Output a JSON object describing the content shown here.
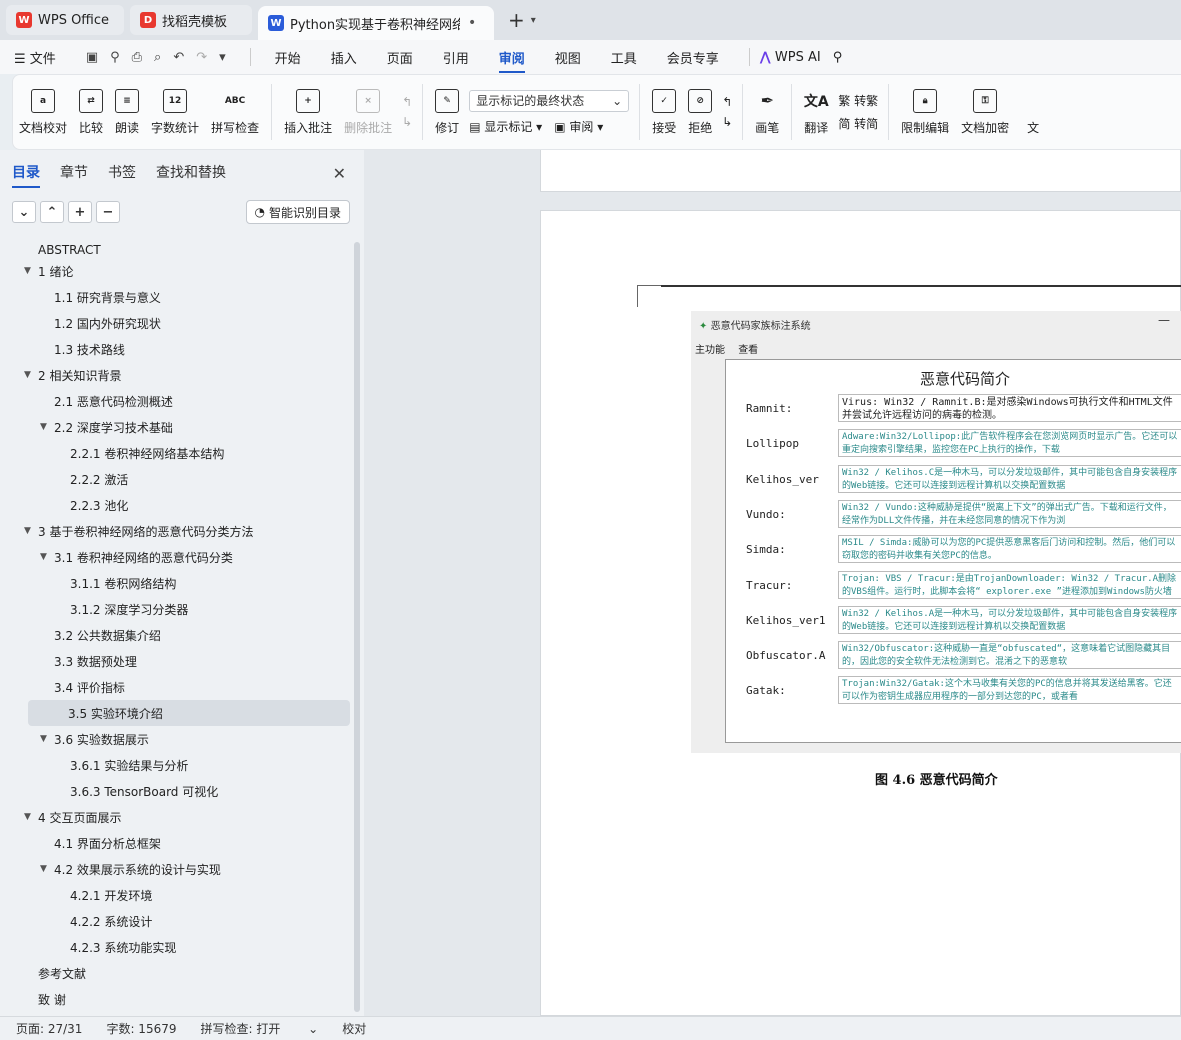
{
  "tabs": [
    {
      "label": "WPS Office",
      "logo": "W",
      "logo_color": "#e8382f"
    },
    {
      "label": "找稻壳模板",
      "logo": "D",
      "logo_color": "#e8382f"
    },
    {
      "label": "Python实现基于卷积神经网络",
      "logo": "W",
      "logo_color": "#2b5cd9",
      "active": true
    }
  ],
  "tab_dot": "•",
  "new_tab": "+",
  "menu": {
    "file": "文件",
    "items": [
      "开始",
      "插入",
      "页面",
      "引用",
      "审阅",
      "视图",
      "工具",
      "会员专享"
    ],
    "active": "审阅",
    "wps_ai": "WPS AI"
  },
  "ribbon": {
    "doc_check": "文档校对",
    "compare": "比较",
    "read": "朗读",
    "word_count": "字数统计",
    "word_count_icon_text": "12",
    "spell_check": "拼写检查",
    "spell_icon_text": "ABC",
    "insert_comment": "插入批注",
    "delete_comment": "删除批注",
    "revise": "修订",
    "markup_state": "显示标记的最终状态",
    "show_markup": "显示标记",
    "review": "审阅",
    "accept": "接受",
    "reject": "拒绝",
    "pen": "画笔",
    "translate": "翻译",
    "to_traditional": "转繁",
    "to_simplified": "转简",
    "restrict_edit": "限制编辑",
    "doc_encrypt": "文档加密",
    "doc_more": "文"
  },
  "nav": {
    "tabs": [
      "目录",
      "章节",
      "书签",
      "查找和替换"
    ],
    "smart_toc": "智能识别目录",
    "toc": [
      {
        "label": "ABSTRACT",
        "level": 0,
        "arrow": false
      },
      {
        "label": "1  绪论",
        "level": 0,
        "arrow": true
      },
      {
        "label": "1.1  研究背景与意义",
        "level": 1,
        "arrow": false
      },
      {
        "label": "1.2  国内外研究现状",
        "level": 1,
        "arrow": false
      },
      {
        "label": "1.3  技术路线",
        "level": 1,
        "arrow": false
      },
      {
        "label": "2  相关知识背景",
        "level": 0,
        "arrow": true
      },
      {
        "label": "2.1  恶意代码检测概述",
        "level": 1,
        "arrow": false
      },
      {
        "label": "2.2  深度学习技术基础",
        "level": 1,
        "arrow": true
      },
      {
        "label": "2.2.1 卷积神经网络基本结构",
        "level": 2,
        "arrow": false
      },
      {
        "label": "2.2.2 激活",
        "level": 2,
        "arrow": false
      },
      {
        "label": "2.2.3 池化",
        "level": 2,
        "arrow": false
      },
      {
        "label": "3  基于卷积神经网络的恶意代码分类方法",
        "level": 0,
        "arrow": true
      },
      {
        "label": "3.1  卷积神经网络的恶意代码分类",
        "level": 1,
        "arrow": true
      },
      {
        "label": "3.1.1 卷积网络结构",
        "level": 2,
        "arrow": false
      },
      {
        "label": "3.1.2  深度学习分类器",
        "level": 2,
        "arrow": false
      },
      {
        "label": "3.2 公共数据集介绍",
        "level": 1,
        "arrow": false
      },
      {
        "label": "3.3 数据预处理",
        "level": 1,
        "arrow": false
      },
      {
        "label": "3.4  评价指标",
        "level": 1,
        "arrow": false
      },
      {
        "label": "3.5  实验环境介绍",
        "level": 1,
        "arrow": false,
        "selected": true
      },
      {
        "label": "3.6  实验数据展示",
        "level": 1,
        "arrow": true
      },
      {
        "label": "3.6.1  实验结果与分析",
        "level": 2,
        "arrow": false
      },
      {
        "label": "3.6.3 TensorBoard 可视化",
        "level": 2,
        "arrow": false
      },
      {
        "label": "4  交互页面展示",
        "level": 0,
        "arrow": true
      },
      {
        "label": "4.1  界面分析总框架",
        "level": 1,
        "arrow": false
      },
      {
        "label": "4.2  效果展示系统的设计与实现",
        "level": 1,
        "arrow": true
      },
      {
        "label": "4.2.1  开发环境",
        "level": 2,
        "arrow": false
      },
      {
        "label": "4.2.2  系统设计",
        "level": 2,
        "arrow": false
      },
      {
        "label": "4.2.3  系统功能实现",
        "level": 2,
        "arrow": false
      },
      {
        "label": "参考文献",
        "level": 0,
        "arrow": false
      },
      {
        "label": "致    谢",
        "level": 0,
        "arrow": false
      }
    ]
  },
  "doc": {
    "window_title": "恶意代码家族标注系统",
    "window_min": "—",
    "window_menu": [
      "主功能",
      "查看"
    ],
    "heading": "恶意代码简介",
    "families": [
      {
        "name": "Ramnit:",
        "desc": "Virus: Win32 / Ramnit.B:是对感染Windows可执行文件和HTML文件并尝试允许远程访问的病毒的检测。",
        "dark": true
      },
      {
        "name": "Lollipop",
        "desc": "Adware:Win32/Lollipop:此广告软件程序会在您浏览网页时显示广告。它还可以重定向搜索引擎结果，监控您在PC上执行的操作，下载"
      },
      {
        "name": "Kelihos_ver",
        "desc": "Win32 / Kelihos.C是一种木马，可以分发垃圾邮件，其中可能包含自身安装程序的Web链接。它还可以连接到远程计算机以交换配置数据"
      },
      {
        "name": "Vundo:",
        "desc": "Win32 / Vundo:这种威胁是提供“脱离上下文”的弹出式广告。下载和运行文件，经常作为DLL文件传播，并在未经您同意的情况下作为浏"
      },
      {
        "name": "Simda:",
        "desc": "MSIL / Simda:威胁可以为您的PC提供恶意黑客后门访问和控制。然后，他们可以窃取您的密码并收集有关您PC的信息。"
      },
      {
        "name": "Tracur:",
        "desc": "Trojan: VBS / Tracur:是由TrojanDownloader: Win32 / Tracur.A删除的VBS组件。运行时，此脚本会将“ explorer.exe ”进程添加到Windows防火墙例外列表中，以故意降低系统安全设"
      },
      {
        "name": "Kelihos_ver1",
        "desc": "Win32 / Kelihos.A是一种木马，可以分发垃圾邮件，其中可能包含自身安装程序的Web链接。它还可以连接到远程计算机以交换配置数据"
      },
      {
        "name": "Obfuscator.A",
        "desc": "Win32/Obfuscator:这种威胁一直是“obfuscated“，这意味着它试图隐藏其目的，因此您的安全软件无法检测到它。混淆之下的恶意软"
      },
      {
        "name": "Gatak:",
        "desc": "Trojan:Win32/Gatak:这个木马收集有关您的PC的信息并将其发送给黑客。它还可以作为密钥生成器应用程序的一部分到达您的PC，或者看"
      }
    ],
    "caption": "图 4.6  恶意代码简介"
  },
  "status": {
    "page": "页面: 27/31",
    "words": "字数: 15679",
    "spell": "拼写检查: 打开",
    "proof": "校对"
  }
}
